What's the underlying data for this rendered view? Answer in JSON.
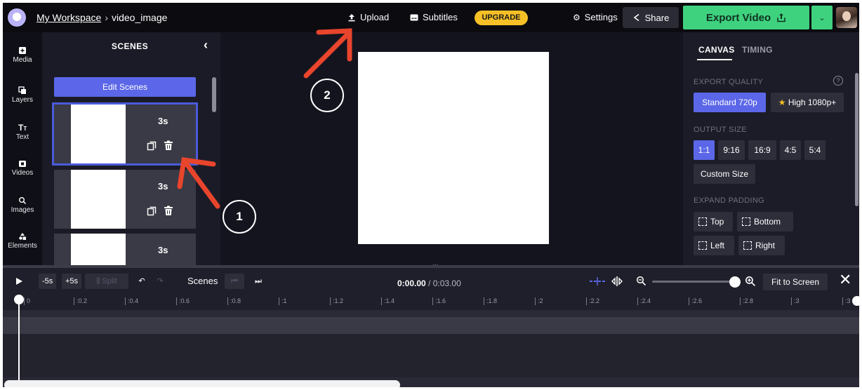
{
  "header": {
    "workspace": "My Workspace",
    "separator": "›",
    "project": "video_image",
    "upload": "Upload",
    "subtitles": "Subtitles",
    "upgrade": "UPGRADE",
    "settings": "Settings",
    "share": "Share",
    "export": "Export Video"
  },
  "rail": {
    "items": [
      {
        "label": "Media",
        "icon": "media-icon"
      },
      {
        "label": "Layers",
        "icon": "layers-icon"
      },
      {
        "label": "Text",
        "icon": "text-icon"
      },
      {
        "label": "Videos",
        "icon": "videos-icon"
      },
      {
        "label": "Images",
        "icon": "search-icon"
      },
      {
        "label": "Elements",
        "icon": "elements-icon"
      }
    ]
  },
  "scenes": {
    "title": "SCENES",
    "edit_label": "Edit Scenes",
    "items": [
      {
        "duration": "3s"
      },
      {
        "duration": "3s"
      },
      {
        "duration": "3s"
      }
    ]
  },
  "right_panel": {
    "tabs": [
      "CANVAS",
      "TIMING"
    ],
    "export_quality_label": "EXPORT QUALITY",
    "quality_options": [
      "Standard 720p",
      "High 1080p+"
    ],
    "quality_selected": "Standard 720p",
    "output_size_label": "OUTPUT SIZE",
    "size_options": [
      "1:1",
      "9:16",
      "16:9",
      "4:5",
      "5:4"
    ],
    "size_selected": "1:1",
    "custom_size": "Custom Size",
    "expand_padding_label": "EXPAND PADDING",
    "padding_options": [
      "Top",
      "Bottom",
      "Left",
      "Right"
    ]
  },
  "timeline": {
    "minus5": "-5s",
    "plus5": "+5s",
    "split": "Split",
    "scenes_label": "Scenes",
    "time_current": "0:00.00",
    "time_total": "/ 0:03.00",
    "fit_label": "Fit to Screen",
    "ruler": [
      "0",
      ":0.2",
      ":0.4",
      ":0.6",
      ":0.8",
      ":1",
      ":1.2",
      ":1.4",
      ":1.6",
      ":1.8",
      ":2",
      ":2.2",
      ":2.4",
      ":2.6",
      ":2.8",
      ":3",
      ":3"
    ]
  },
  "annotations": {
    "step1": "1",
    "step2": "2",
    "arrow_color": "#e8452c"
  },
  "colors": {
    "accent_blue": "#5b67e8",
    "export_green": "#3ed27f",
    "upgrade_yellow": "#f6c026"
  }
}
